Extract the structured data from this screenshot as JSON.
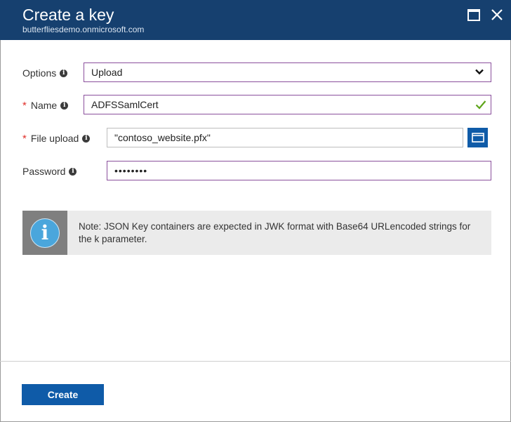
{
  "header": {
    "title": "Create a key",
    "subtitle": "butterfliesdemo.onmicrosoft.com",
    "background": "#16406f"
  },
  "form": {
    "options": {
      "label": "Options",
      "value": "Upload"
    },
    "name": {
      "label": "Name",
      "value": "ADFSSamlCert",
      "required_marker": "*"
    },
    "file_upload": {
      "label": "File upload",
      "value": "\"contoso_website.pfx\"",
      "required_marker": "*"
    },
    "password": {
      "label": "Password",
      "value": "••••••••"
    },
    "info_glyph": "i"
  },
  "note": {
    "icon_glyph": "i",
    "text": "Note: JSON Key containers are expected in JWK format with Base64 URLencoded strings for the k parameter."
  },
  "footer": {
    "create_label": "Create",
    "accent": "#0f5ba8"
  },
  "icons": {
    "maximize": "maximize-icon",
    "close": "close-icon",
    "chevron": "chevron-down-icon",
    "check": "checkmark-icon",
    "folder": "folder-icon",
    "info": "info-icon"
  }
}
